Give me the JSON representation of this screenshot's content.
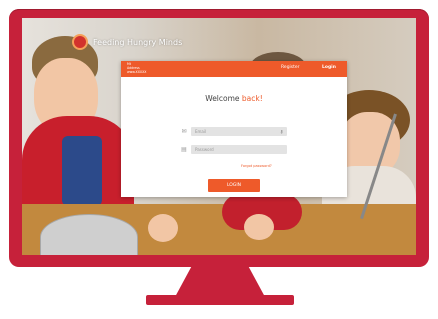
{
  "brand": {
    "name": "Feeding Hungry Minds"
  },
  "window": {
    "address_lines": [
      "Mt",
      "Address",
      "www.XXXXX"
    ],
    "tabs": {
      "register": "Register",
      "login": "Login"
    },
    "welcome": {
      "prefix": "Welcome ",
      "accent": "back!"
    },
    "email": {
      "placeholder": "Email"
    },
    "password": {
      "placeholder": "Password"
    },
    "forgot_label": "Forgot password?",
    "login_button": "LOGIN"
  },
  "colors": {
    "frame": "#c6213a",
    "accent": "#ee5a2a"
  }
}
